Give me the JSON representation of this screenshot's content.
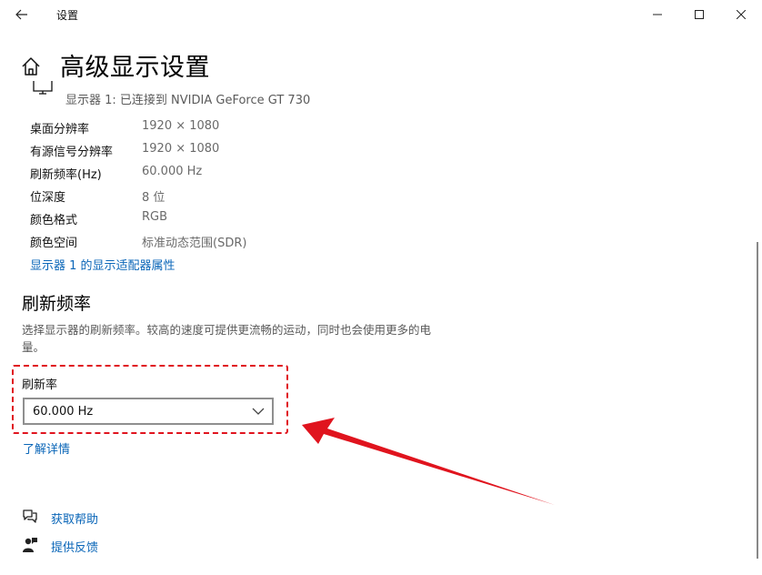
{
  "window": {
    "title": "设置",
    "back_icon": "back-arrow-icon",
    "controls": [
      "minimize-icon",
      "maximize-icon",
      "close-icon"
    ]
  },
  "page": {
    "title": "高级显示设置",
    "home_icon": "home-icon"
  },
  "display": {
    "monitor_icon": "monitor-icon",
    "connection_text": "显示器 1: 已连接到 NVIDIA GeForce GT 730",
    "info": [
      {
        "label": "桌面分辨率",
        "value": "1920 × 1080"
      },
      {
        "label": "有源信号分辨率",
        "value": "1920 × 1080"
      },
      {
        "label": "刷新频率(Hz)",
        "value": "60.000 Hz"
      },
      {
        "label": "位深度",
        "value": "8 位"
      },
      {
        "label": "颜色格式",
        "value": "RGB"
      },
      {
        "label": "颜色空间",
        "value": "标准动态范围(SDR)"
      }
    ],
    "adapter_link": "显示器 1 的显示适配器属性"
  },
  "refresh": {
    "section_title": "刷新频率",
    "description": "选择显示器的刷新频率。较高的速度可提供更流畅的运动，同时也会使用更多的电量。",
    "dropdown_label": "刷新率",
    "dropdown_value": "60.000 Hz",
    "learn_more": "了解详情"
  },
  "footer": {
    "help": "获取帮助",
    "feedback": "提供反馈"
  },
  "colors": {
    "link": "#0a66b8",
    "annotation": "#e0141e"
  }
}
